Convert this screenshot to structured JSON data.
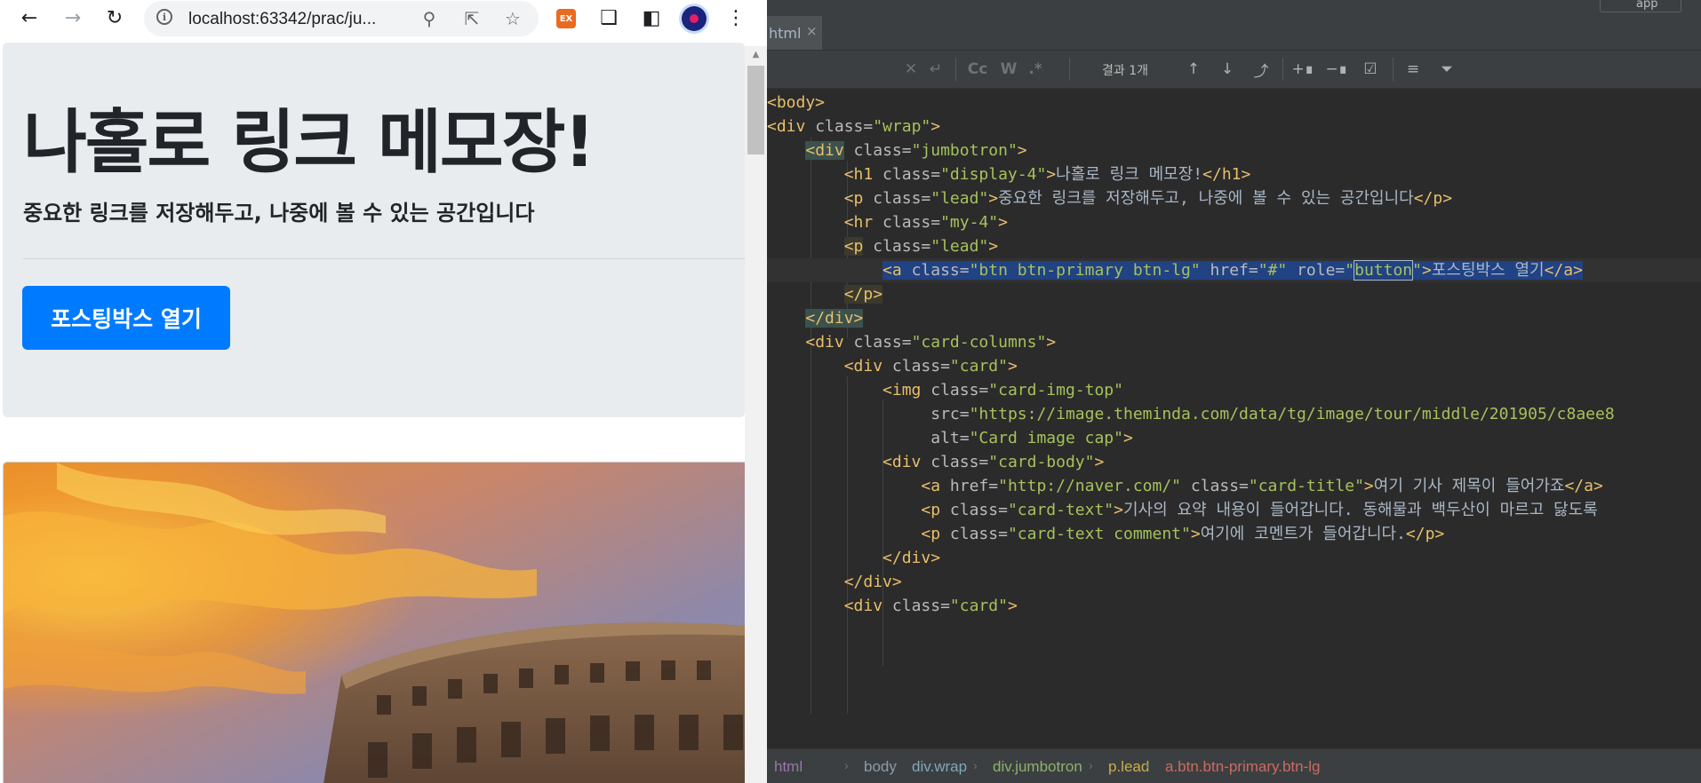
{
  "browser": {
    "url": "localhost:63342/prac/ju...",
    "extension_badge": "EX",
    "toolbar_icons": [
      "back-arrow-icon",
      "forward-arrow-icon",
      "reload-icon",
      "zoom-icon",
      "share-icon",
      "star-icon",
      "puzzle-icon",
      "side-panel-icon",
      "kebab-menu-icon"
    ]
  },
  "page": {
    "title": "나홀로 링크 메모장!",
    "lead": "중요한 링크를 저장해두고, 나중에 볼 수 있는 공간입니다",
    "button_label": "포스팅박스 열기",
    "button_color": "#007bff",
    "jumbotron_bg": "#e9ecef"
  },
  "ide": {
    "tab_label": "html",
    "tab_close": "×",
    "topbar_label": "app",
    "find_bar": {
      "case_label": "Cc",
      "word_label": "W",
      "regex_label": ".*",
      "result": "결과 1개"
    },
    "code_lines": [
      {
        "indent": "",
        "parts": [
          [
            "tag",
            "<body>"
          ]
        ]
      },
      {
        "indent": "",
        "parts": [
          [
            "tag",
            "<div"
          ],
          [
            "attr",
            " class="
          ],
          [
            "val",
            "\"wrap\""
          ],
          [
            "tag",
            ">"
          ]
        ]
      },
      {
        "indent": "    ",
        "parts": [
          [
            "tag",
            "<div"
          ],
          [
            "attr",
            " class="
          ],
          [
            "val",
            "\"jumbotron\""
          ],
          [
            "tag",
            ">"
          ]
        ]
      },
      {
        "indent": "        ",
        "parts": [
          [
            "tag",
            "<h1"
          ],
          [
            "attr",
            " class="
          ],
          [
            "val",
            "\"display-4\""
          ],
          [
            "tag",
            ">"
          ],
          [
            "txt",
            "나홀로 링크 메모장!"
          ],
          [
            "tag",
            "</h1>"
          ]
        ]
      },
      {
        "indent": "        ",
        "parts": [
          [
            "tag",
            "<p"
          ],
          [
            "attr",
            " class="
          ],
          [
            "val",
            "\"lead\""
          ],
          [
            "tag",
            ">"
          ],
          [
            "txt",
            "중요한 링크를 저장해두고, 나중에 볼 수 있는 공간입니다"
          ],
          [
            "tag",
            "</p>"
          ]
        ]
      },
      {
        "indent": "        ",
        "parts": [
          [
            "tag",
            "<hr"
          ],
          [
            "attr",
            " class="
          ],
          [
            "val",
            "\"my-4\""
          ],
          [
            "tag",
            ">"
          ]
        ]
      },
      {
        "indent": "        ",
        "parts": [
          [
            "tag",
            "<p"
          ],
          [
            "attr",
            " class="
          ],
          [
            "val",
            "\"lead\""
          ],
          [
            "tag",
            ">"
          ]
        ]
      },
      {
        "indent": "            ",
        "parts": [
          [
            "tag",
            "<a"
          ],
          [
            "attr",
            " class="
          ],
          [
            "val",
            "\"btn btn-primary btn-lg\""
          ],
          [
            "attr",
            " href="
          ],
          [
            "val",
            "\"#\""
          ],
          [
            "attr",
            " role="
          ],
          [
            "val",
            "\"button\""
          ],
          [
            "tag",
            ">"
          ],
          [
            "txt",
            "포스팅박스 열기"
          ],
          [
            "tag",
            "</a>"
          ]
        ]
      },
      {
        "indent": "        ",
        "parts": [
          [
            "tag",
            "</p>"
          ]
        ]
      },
      {
        "indent": "    ",
        "parts": [
          [
            "tag",
            "</div>"
          ]
        ]
      },
      {
        "indent": "    ",
        "parts": [
          [
            "tag",
            "<div"
          ],
          [
            "attr",
            " class="
          ],
          [
            "val",
            "\"card-columns\""
          ],
          [
            "tag",
            ">"
          ]
        ]
      },
      {
        "indent": "        ",
        "parts": [
          [
            "tag",
            "<div"
          ],
          [
            "attr",
            " class="
          ],
          [
            "val",
            "\"card\""
          ],
          [
            "tag",
            ">"
          ]
        ]
      },
      {
        "indent": "            ",
        "parts": [
          [
            "tag",
            "<img"
          ],
          [
            "attr",
            " class="
          ],
          [
            "val",
            "\"card-img-top\""
          ]
        ]
      },
      {
        "indent": "                 ",
        "parts": [
          [
            "attr",
            "src="
          ],
          [
            "val",
            "\"https://image.theminda.com/data/tg/image/tour/middle/201905/c8aee8"
          ]
        ]
      },
      {
        "indent": "                 ",
        "parts": [
          [
            "attr",
            "alt="
          ],
          [
            "val",
            "\"Card image cap\""
          ],
          [
            "tag",
            ">"
          ]
        ]
      },
      {
        "indent": "            ",
        "parts": [
          [
            "tag",
            "<div"
          ],
          [
            "attr",
            " class="
          ],
          [
            "val",
            "\"card-body\""
          ],
          [
            "tag",
            ">"
          ]
        ]
      },
      {
        "indent": "                ",
        "parts": [
          [
            "tag",
            "<a"
          ],
          [
            "attr",
            " href="
          ],
          [
            "val",
            "\"http://naver.com/\""
          ],
          [
            "attr",
            " class="
          ],
          [
            "val",
            "\"card-title\""
          ],
          [
            "tag",
            ">"
          ],
          [
            "txt",
            "여기 기사 제목이 들어가죠"
          ],
          [
            "tag",
            "</a>"
          ]
        ]
      },
      {
        "indent": "                ",
        "parts": [
          [
            "tag",
            "<p"
          ],
          [
            "attr",
            " class="
          ],
          [
            "val",
            "\"card-text\""
          ],
          [
            "tag",
            ">"
          ],
          [
            "txt",
            "기사의 요약 내용이 들어갑니다. 동해물과 백두산이 마르고 닳도록"
          ]
        ]
      },
      {
        "indent": "                ",
        "parts": [
          [
            "tag",
            "<p"
          ],
          [
            "attr",
            " class="
          ],
          [
            "val",
            "\"card-text comment\""
          ],
          [
            "tag",
            ">"
          ],
          [
            "txt",
            "여기에 코멘트가 들어갑니다."
          ],
          [
            "tag",
            "</p>"
          ]
        ]
      },
      {
        "indent": "            ",
        "parts": [
          [
            "tag",
            "</div>"
          ]
        ]
      },
      {
        "indent": "        ",
        "parts": [
          [
            "tag",
            "</div>"
          ]
        ]
      },
      {
        "indent": "        ",
        "parts": [
          [
            "tag",
            "<div"
          ],
          [
            "attr",
            " class="
          ],
          [
            "val",
            "\"card\""
          ],
          [
            "tag",
            ">"
          ]
        ]
      }
    ],
    "breadcrumb": [
      {
        "label": "html",
        "color": "#9876aa"
      },
      {
        "label": "body",
        "color": "#8c9ba8"
      },
      {
        "label": "div.wrap",
        "color": "#7fa8b8"
      },
      {
        "label": "div.jumbotron",
        "color": "#8fb06b"
      },
      {
        "label": "p.lead",
        "color": "#c7b04a"
      },
      {
        "label": "a.btn.btn-primary.btn-lg",
        "color": "#cc6a5e"
      }
    ]
  }
}
